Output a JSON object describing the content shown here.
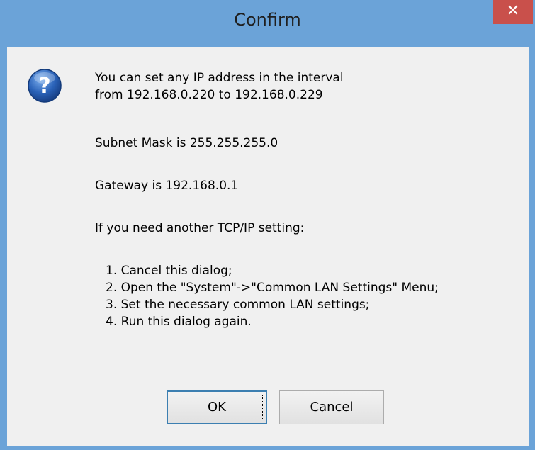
{
  "window": {
    "title": "Confirm",
    "close_glyph": "✕"
  },
  "dialog": {
    "icon": "question-icon",
    "lines": [
      "You can set any IP address in the interval",
      "from 192.168.0.220 to 192.168.0.229",
      "Subnet Mask is 255.255.255.0",
      "Gateway is 192.168.0.1",
      "If you need another TCP/IP setting:",
      "1. Cancel this dialog;",
      "2. Open the \"System\"->\"Common LAN Settings\" Menu;",
      "3. Set the necessary common LAN settings;",
      "4. Run this dialog again."
    ]
  },
  "buttons": {
    "ok_label": "OK",
    "cancel_label": "Cancel"
  },
  "colors": {
    "titlebar": "#6ba3d8",
    "close_button": "#c9504b",
    "client_background": "#f0f0f0",
    "icon_blue": "#2a62b8"
  }
}
